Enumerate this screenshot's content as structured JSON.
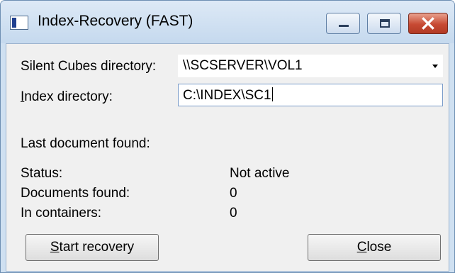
{
  "window": {
    "title": "Index-Recovery (FAST)"
  },
  "titlebar_buttons": {
    "minimize": "minimize-icon",
    "maximize": "maximize-icon",
    "close": "close-icon"
  },
  "form": {
    "cubes_dir_label": "Silent Cubes directory:",
    "cubes_dir_value": "\\\\SCSERVER\\VOL1",
    "index_dir_label_first": "I",
    "index_dir_label_rest": "ndex directory:",
    "index_dir_value": "C:\\INDEX\\SC1"
  },
  "status": {
    "last_doc_label": "Last document found:",
    "status_label": "Status:",
    "status_value": "Not active",
    "docs_found_label": "Documents found:",
    "docs_found_value": "0",
    "in_containers_label": "In containers:",
    "in_containers_value": "0"
  },
  "buttons": {
    "start_first": "S",
    "start_rest": "tart recovery",
    "close_first": "C",
    "close_rest": "lose"
  },
  "colors": {
    "close_button": "#c74a33",
    "client_bg": "#f0f0f0",
    "frame": "#cfe0f1"
  }
}
